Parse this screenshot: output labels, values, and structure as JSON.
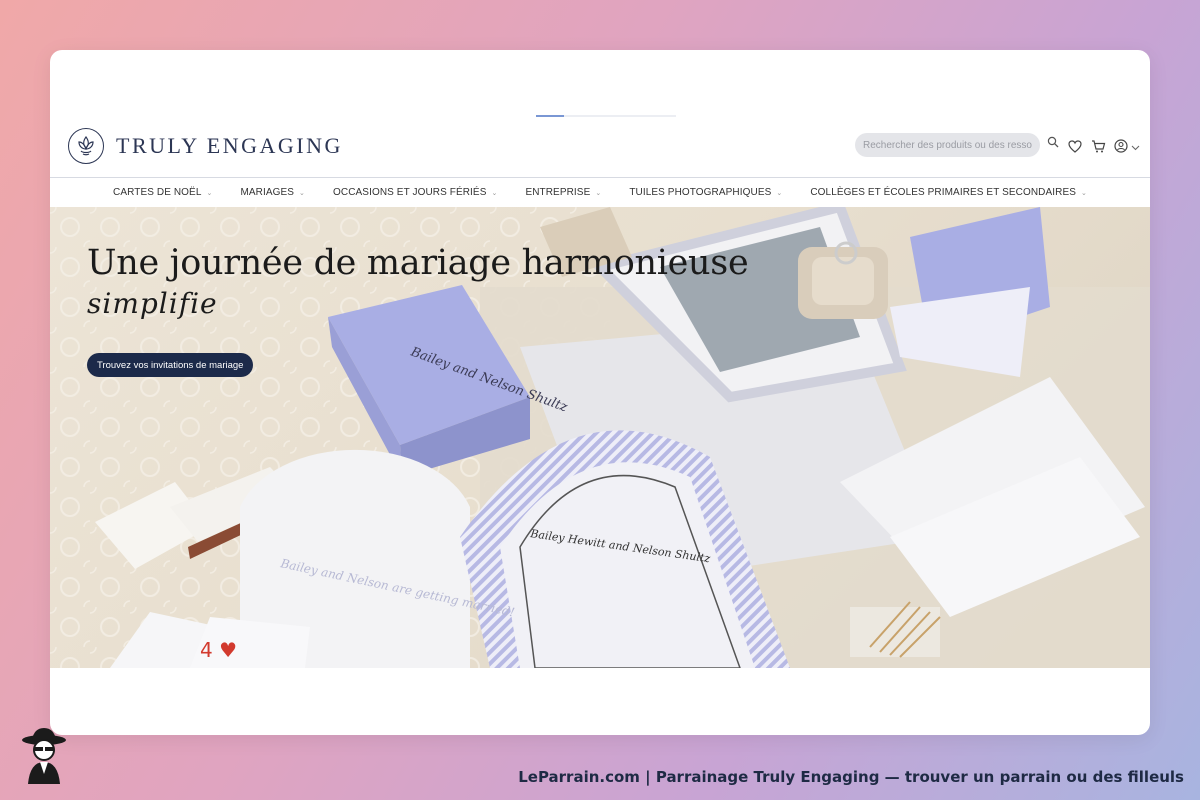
{
  "header": {
    "brand": "TRULY ENGAGING",
    "search_placeholder": "Rechercher des produits ou des ressources...",
    "icons": [
      "search-icon",
      "heart-icon",
      "cart-icon",
      "user-icon",
      "chevron-down-icon"
    ]
  },
  "loading": {
    "progress": 0.2
  },
  "nav": {
    "items": [
      {
        "label": "CARTES DE NOËL",
        "has_dropdown": true
      },
      {
        "label": "MARIAGES",
        "has_dropdown": true
      },
      {
        "label": "OCCASIONS ET JOURS FÉRIÉS",
        "has_dropdown": true
      },
      {
        "label": "ENTREPRISE",
        "has_dropdown": true
      },
      {
        "label": "TUILES PHOTOGRAPHIQUES",
        "has_dropdown": true
      },
      {
        "label": "COLLÈGES ET ÉCOLES PRIMAIRES ET SECONDAIRES",
        "has_dropdown": true
      }
    ]
  },
  "hero": {
    "title": "Une journée de mariage harmonieuse",
    "subtitle": "simplifie",
    "cta_label": "Trouvez vos invitations de mariage",
    "card_texts": {
      "box_names": "Bailey and Nelson Shultz",
      "invite_names": "Bailey Hewitt and Nelson Shultz",
      "round_card": "Bailey and Nelson are getting married!"
    }
  },
  "footer": {
    "caption": "LeParrain.com | Parrainage Truly Engaging — trouver un parrain ou des filleuls"
  },
  "colors": {
    "accent": "#1c2a4a",
    "brand": "#2c3654",
    "lavender": "#a9aee4",
    "progress": "#7a97d4"
  }
}
